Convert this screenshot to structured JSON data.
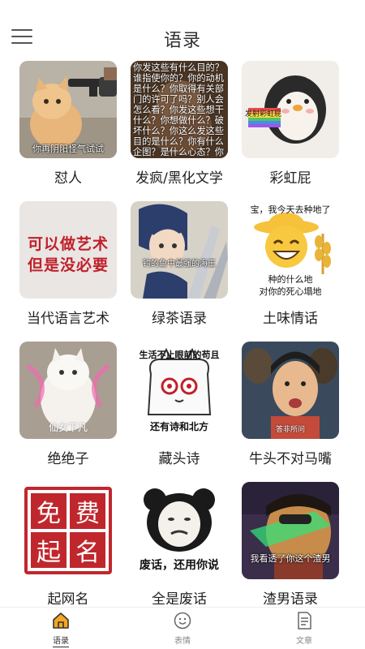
{
  "header": {
    "title": "语录",
    "menu_icon": "hamburger-menu-icon"
  },
  "categories": [
    {
      "label": "怼人",
      "caption": "你再阴阳怪气试试"
    },
    {
      "label": "发疯/黑化文学",
      "caption": "你发这些有什么目的？谁指使你的？你的动机是什么？你取得有关部门的许可了吗？别人会怎么看？你发这些想干什么？你想做什么？破坏什么？你这么发这些目的是什么？你有什么企图？是什么心态？你思想有什么问题？你想报复谁？"
    },
    {
      "label": "彩虹屁",
      "caption": "发射彩虹屁"
    },
    {
      "label": "当代语言艺术",
      "caption_line1": "可以做艺术",
      "caption_line2": "但是没必要"
    },
    {
      "label": "绿茶语录",
      "caption": "钓的鱼中最强的海王"
    },
    {
      "label": "土味情话",
      "caption_top": "宝，我今天去种地了",
      "caption_mid": "种的什么地",
      "caption_bottom": "对你的死心塌地"
    },
    {
      "label": "绝绝子",
      "caption": "仙女下凡"
    },
    {
      "label": "藏头诗",
      "caption_top": "生活不止眼前的苟且",
      "caption_bottom": "还有诗和北方"
    },
    {
      "label": "牛头不对马嘴",
      "caption": "答非所问"
    },
    {
      "label": "起网名",
      "chars": [
        "免",
        "费",
        "起",
        "名"
      ]
    },
    {
      "label": "全是废话",
      "caption": "废话，还用你说"
    },
    {
      "label": "渣男语录",
      "caption": "我看透了你这个渣男"
    }
  ],
  "tabs": [
    {
      "label": "语录",
      "icon": "home-icon",
      "active": true
    },
    {
      "label": "表情",
      "icon": "smiley-icon",
      "active": false
    },
    {
      "label": "文章",
      "icon": "document-icon",
      "active": false
    }
  ],
  "colors": {
    "accent": "#f5a623",
    "seal_red": "#c0272d"
  }
}
